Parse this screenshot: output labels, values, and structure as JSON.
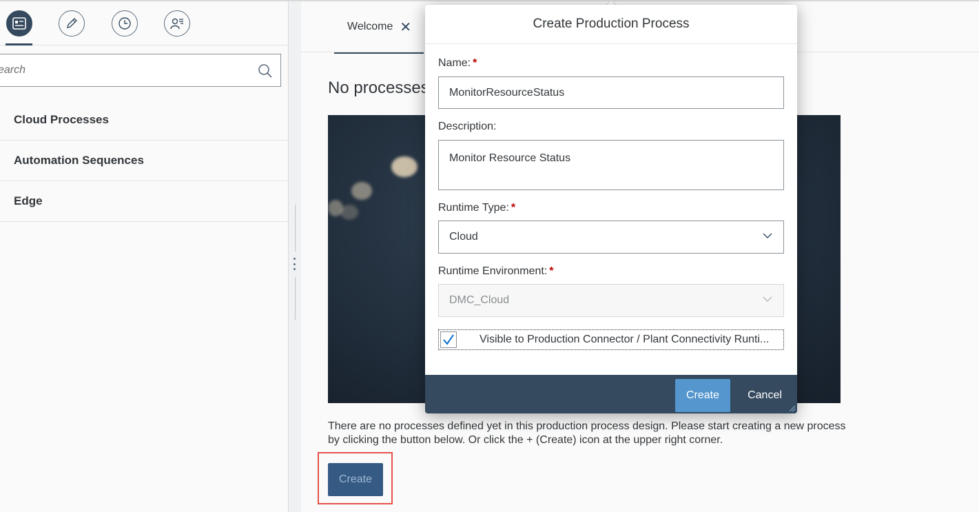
{
  "left": {
    "tabs": [
      {
        "icon": "process-list-icon"
      },
      {
        "icon": "pencil-icon"
      },
      {
        "icon": "clock-icon"
      },
      {
        "icon": "user-settings-icon"
      }
    ],
    "search_placeholder": "Search",
    "search_value": "earch",
    "nav_items": [
      {
        "label": "Cloud Processes"
      },
      {
        "label": "Automation Sequences"
      },
      {
        "label": "Edge"
      }
    ]
  },
  "main": {
    "tab_label": "Welcome",
    "tab_close": "✕",
    "heading": "No processes",
    "description": "There are no processes defined yet in this production process design. Please start creating a new process by clicking the button below. Or click the + (Create) icon at the upper right corner.",
    "create_label": "Create"
  },
  "dialog": {
    "title": "Create Production Process",
    "name_label": "Name:",
    "name_value": "MonitorResourceStatus",
    "description_label": "Description:",
    "description_value": "Monitor Resource Status",
    "runtime_type_label": "Runtime Type:",
    "runtime_type_value": "Cloud",
    "runtime_env_label": "Runtime Environment:",
    "runtime_env_value": "DMC_Cloud",
    "required_mark": "*",
    "visible_checkbox_label": "Visible to Production Connector / Plant Connectivity Runti...",
    "visible_checked": true,
    "create_label": "Create",
    "cancel_label": "Cancel"
  },
  "colors": {
    "shell_dark": "#354a5f",
    "accent_button": "#5496cd",
    "required": "#bb0000",
    "highlight_box": "#e5514a"
  }
}
